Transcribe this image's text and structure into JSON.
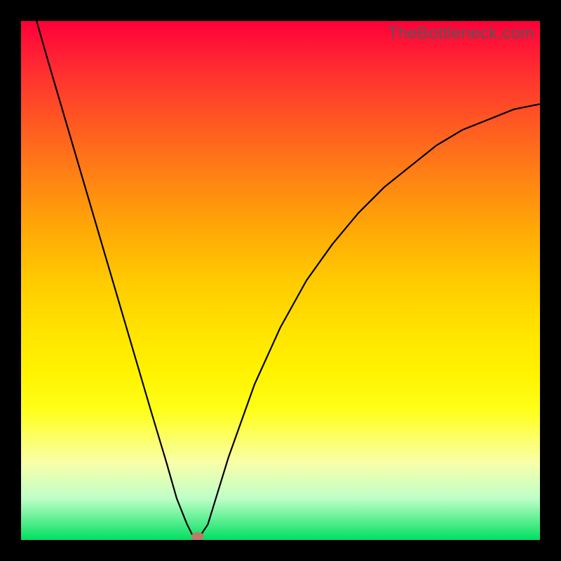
{
  "watermark": "TheBottleneck.com",
  "chart_data": {
    "type": "line",
    "title": "",
    "xlabel": "",
    "ylabel": "",
    "xlim": [
      0,
      100
    ],
    "ylim": [
      0,
      100
    ],
    "series": [
      {
        "name": "bottleneck-curve",
        "x": [
          3,
          5,
          10,
          15,
          20,
          25,
          28,
          30,
          32,
          33,
          34,
          36,
          40,
          45,
          50,
          55,
          60,
          65,
          70,
          75,
          80,
          85,
          90,
          95,
          100
        ],
        "y": [
          100,
          93,
          76,
          59,
          42,
          25,
          15,
          8,
          3,
          1,
          0,
          3,
          16,
          30,
          41,
          50,
          57,
          63,
          68,
          72,
          76,
          79,
          81,
          83,
          84
        ]
      }
    ],
    "marker": {
      "x": 34,
      "y": 0
    },
    "gradient_colors": {
      "top": "#ff003a",
      "mid": "#ffe400",
      "bottom": "#00e060"
    }
  }
}
